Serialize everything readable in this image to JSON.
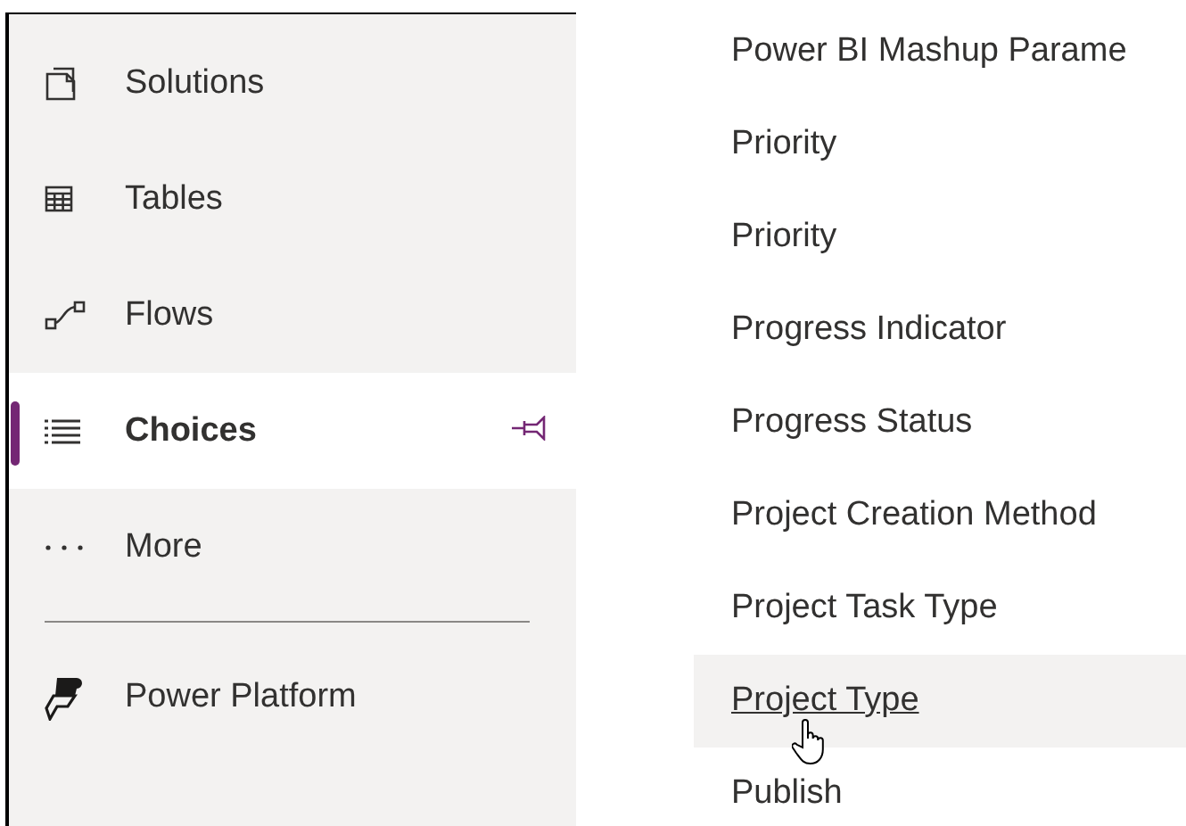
{
  "sidebar": {
    "items": [
      {
        "label": "Solutions",
        "selected": false,
        "pinned": false
      },
      {
        "label": "Tables",
        "selected": false,
        "pinned": false
      },
      {
        "label": "Flows",
        "selected": false,
        "pinned": false
      },
      {
        "label": "Choices",
        "selected": true,
        "pinned": true
      },
      {
        "label": "More",
        "selected": false,
        "pinned": false
      }
    ],
    "footer_item": {
      "label": "Power Platform"
    }
  },
  "list": {
    "items": [
      {
        "label": "Power BI Mashup Parame",
        "hovered": false
      },
      {
        "label": "Priority",
        "hovered": false
      },
      {
        "label": "Priority",
        "hovered": false
      },
      {
        "label": "Progress Indicator",
        "hovered": false
      },
      {
        "label": "Progress Status",
        "hovered": false
      },
      {
        "label": "Project Creation Method",
        "hovered": false
      },
      {
        "label": "Project Task Type",
        "hovered": false
      },
      {
        "label": "Project Type",
        "hovered": true
      },
      {
        "label": "Publish",
        "hovered": false
      }
    ]
  }
}
